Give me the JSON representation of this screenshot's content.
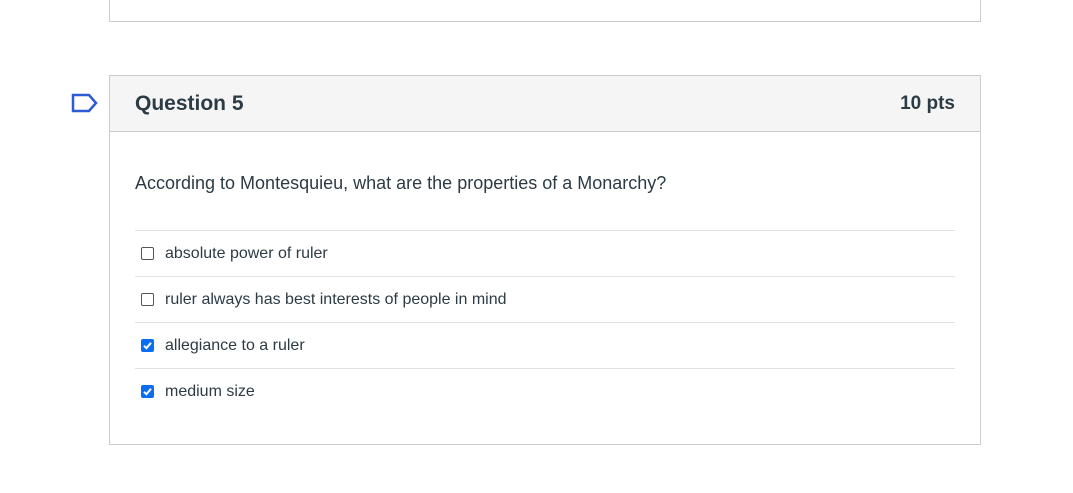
{
  "question": {
    "title": "Question 5",
    "points": "10 pts",
    "text": "According to Montesquieu, what are the properties of a Monarchy?",
    "flag_icon": "bookmark-flag-icon",
    "answers": [
      {
        "label": "absolute power of ruler",
        "checked": false
      },
      {
        "label": "ruler always has best interests of people in mind",
        "checked": false
      },
      {
        "label": "allegiance to a ruler",
        "checked": true
      },
      {
        "label": "medium size",
        "checked": true
      }
    ]
  },
  "colors": {
    "accent": "#0b6ef0",
    "text": "#2d3b45",
    "border": "#c7cdd1",
    "header_bg": "#f5f5f5",
    "flag": "#2d5bd6"
  }
}
